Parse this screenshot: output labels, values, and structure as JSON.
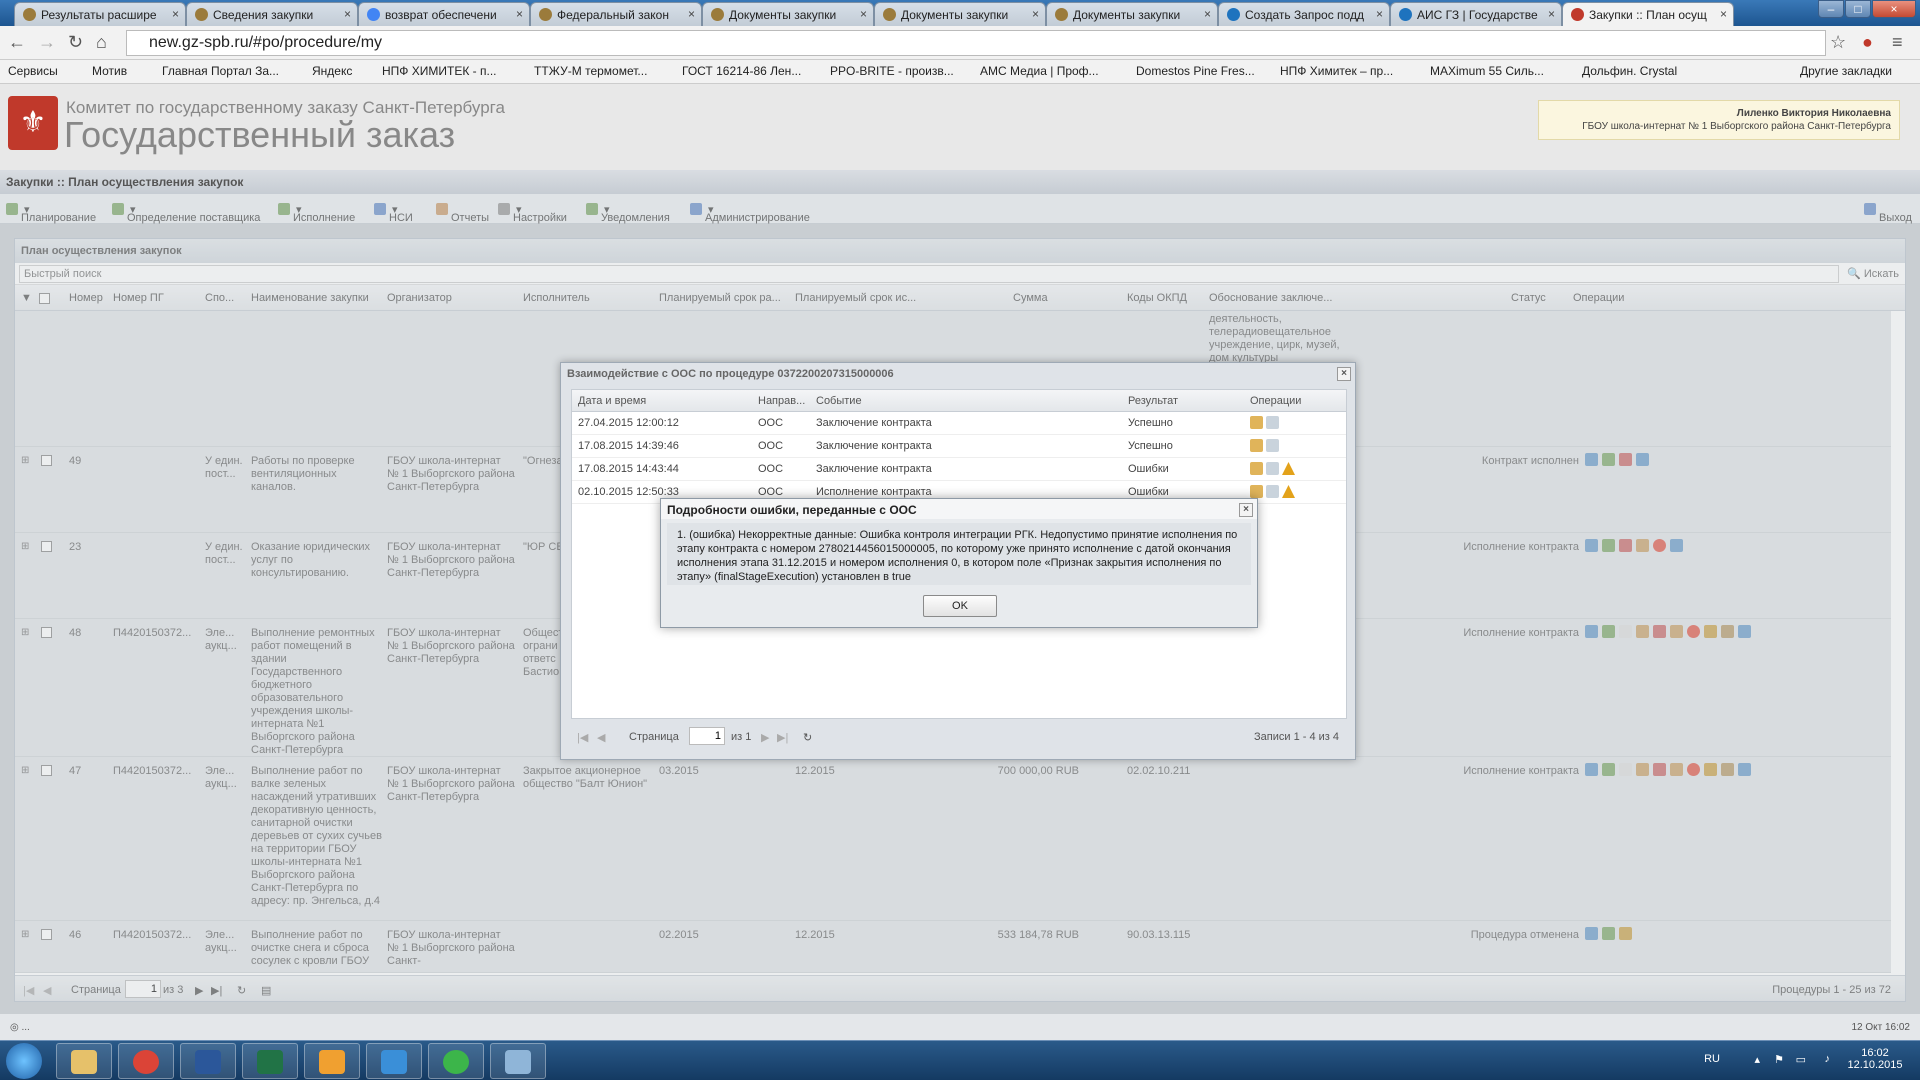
{
  "browser": {
    "tabs": [
      {
        "label": "Результаты расшире",
        "active": false
      },
      {
        "label": "Сведения закупки",
        "active": false
      },
      {
        "label": "возврат обеспечени",
        "active": false
      },
      {
        "label": "Федеральный закон",
        "active": false
      },
      {
        "label": "Документы закупки",
        "active": false
      },
      {
        "label": "Документы закупки",
        "active": false
      },
      {
        "label": "Документы закупки",
        "active": false
      },
      {
        "label": "Создать Запрос подд",
        "active": false
      },
      {
        "label": "АИС ГЗ | Государстве",
        "active": false
      },
      {
        "label": "Закупки :: План осущ",
        "active": true
      }
    ],
    "url": "new.gz-spb.ru/#po/procedure/my",
    "bookmarks": [
      "Сервисы",
      "Мотив",
      "Главная Портал За...",
      "Яндекс",
      "НПФ ХИМИТЕК - п...",
      "ТТЖУ-М термомет...",
      "ГОСТ 16214-86 Лен...",
      "PPO-BRITE - произв...",
      "AMC Медиа | Проф...",
      "Domestos Pine Fres...",
      "НПФ Химитек – пр...",
      "MAXimum 55 Силь...",
      "Дольфин. Crystal",
      "Другие закладки"
    ]
  },
  "header": {
    "committee": "Комитет по государственному заказу Санкт-Петербурга",
    "title": "Государственный заказ",
    "user_name": "Лиленко Виктория Николаевна",
    "user_org": "ГБОУ школа-интернат № 1 Выборгского района Санкт-Петербурга"
  },
  "breadcrumb": "Закупки :: План осуществления закупок",
  "menu": [
    "Планирование",
    "Определение поставщика",
    "Исполнение",
    "НСИ",
    "Отчеты",
    "Настройки",
    "Уведомления",
    "Администрирование"
  ],
  "exit_label": "Выход",
  "panel": {
    "title": "План осуществления закупок",
    "search_placeholder": "Быстрый поиск",
    "search_button": "Искать",
    "columns": [
      "Номер",
      "Номер ПГ",
      "Спо...",
      "Наименование закупки",
      "Организатор",
      "Исполнитель",
      "Планируемый срок ра...",
      "Планируемый срок ис...",
      "Сумма",
      "Коды ОКПД",
      "Обоснование заключе...",
      "Статус",
      "Операции"
    ],
    "top_fragment": "деятельность, телерадиовещательное учреждение, цирк, музей, дом культуры",
    "rows": [
      {
        "num": "49",
        "pg": "",
        "method": "У един. пост...",
        "name": "Работы по проверке вентиляционных каналов.",
        "org": "ГБОУ школа-интернат № 1 Выборгского района Санкт-Петербурга",
        "exec": "\"Огнеза",
        "start": "",
        "end": "",
        "sum": "",
        "okpd": "",
        "status": "Контракт исполнен"
      },
      {
        "num": "23",
        "pg": "",
        "method": "У един. пост...",
        "name": "Оказание юридических услуг по консультированию.",
        "org": "ГБОУ школа-интернат № 1 Выборгского района Санкт-Петербурга",
        "exec": "\"ЮР СЕ",
        "start": "",
        "end": "",
        "sum": "",
        "okpd": "",
        "status": "Исполнение контракта"
      },
      {
        "num": "48",
        "pg": "П4420150372...",
        "method": "Эле... аукц...",
        "name": "Выполнение ремонтных работ помещений в здании Государственного бюджетного образовательного учреждения школы-интерната №1 Выборгского района Санкт-Петербурга",
        "org": "ГБОУ школа-интернат № 1 Выборгского района Санкт-Петербурга",
        "exec": "Общест ограни ответс Бастио",
        "start": "",
        "end": "",
        "sum": "",
        "okpd": "",
        "status": "Исполнение контракта"
      },
      {
        "num": "47",
        "pg": "П4420150372...",
        "method": "Эле... аукц...",
        "name": "Выполнение работ по валке зеленых насаждений утративших декоративную ценность, санитарной очистки деревьев от сухих сучьев на территории ГБОУ школы-интерната №1 Выборгского района Санкт-Петербурга по адресу: пр. Энгельса, д.4",
        "org": "ГБОУ школа-интернат № 1 Выборгского района Санкт-Петербурга",
        "exec": "Закрытое акционерное общество \"Балт Юнион\"",
        "start": "03.2015",
        "end": "12.2015",
        "sum": "700 000,00 RUB",
        "okpd": "02.02.10.211",
        "status": "Исполнение контракта"
      },
      {
        "num": "46",
        "pg": "П4420150372...",
        "method": "Эле... аукц...",
        "name": "Выполнение работ по очистке снега и сброса сосулек с кровли ГБОУ",
        "org": "ГБОУ школа-интернат № 1 Выборгского района Санкт-",
        "exec": "",
        "start": "02.2015",
        "end": "12.2015",
        "sum": "533 184,78 RUB",
        "okpd": "90.03.13.115",
        "status": "Процедура отменена"
      }
    ],
    "pager": {
      "page_label": "Страница",
      "page": "1",
      "of": "из 3",
      "summary": "Процедуры 1 - 25 из 72"
    }
  },
  "dialog": {
    "title": "Взаимодействие с ООС по процедуре 0372200207315000006",
    "columns": [
      "Дата и время",
      "Направ...",
      "Событие",
      "Результат",
      "Операции"
    ],
    "rows": [
      {
        "date": "27.04.2015 12:00:12",
        "dir": "ООС",
        "event": "Заключение контракта",
        "result": "Успешно"
      },
      {
        "date": "17.08.2015 14:39:46",
        "dir": "ООС",
        "event": "Заключение контракта",
        "result": "Успешно"
      },
      {
        "date": "17.08.2015 14:43:44",
        "dir": "ООС",
        "event": "Заключение контракта",
        "result": "Ошибки"
      },
      {
        "date": "02.10.2015 12:50:33",
        "dir": "ООС",
        "event": "Исполнение контракта",
        "result": "Ошибки"
      }
    ],
    "pager": {
      "page_label": "Страница",
      "page": "1",
      "of": "из 1",
      "summary": "Записи 1 - 4 из 4"
    }
  },
  "error": {
    "title": "Подробности ошибки, переданные с ООС",
    "message": "1. (ошибка) Некорректные данные: Ошибка контроля интеграции РГК. Недопустимо принятие исполнения по этапу контракта с номером 2780214456015000005, по которому уже принято исполнение с датой окончания исполнения этапа 31.12.2015 и номером исполнения 0, в котором поле «Признак закрытия исполнения по этапу» (finalStageExecution) установлен в true",
    "ok": "OK"
  },
  "statusbar": {
    "left": "◎ ...",
    "right": "12 Окт 16:02"
  },
  "tray": {
    "lang": "RU",
    "time": "16:02",
    "date": "12.10.2015"
  }
}
